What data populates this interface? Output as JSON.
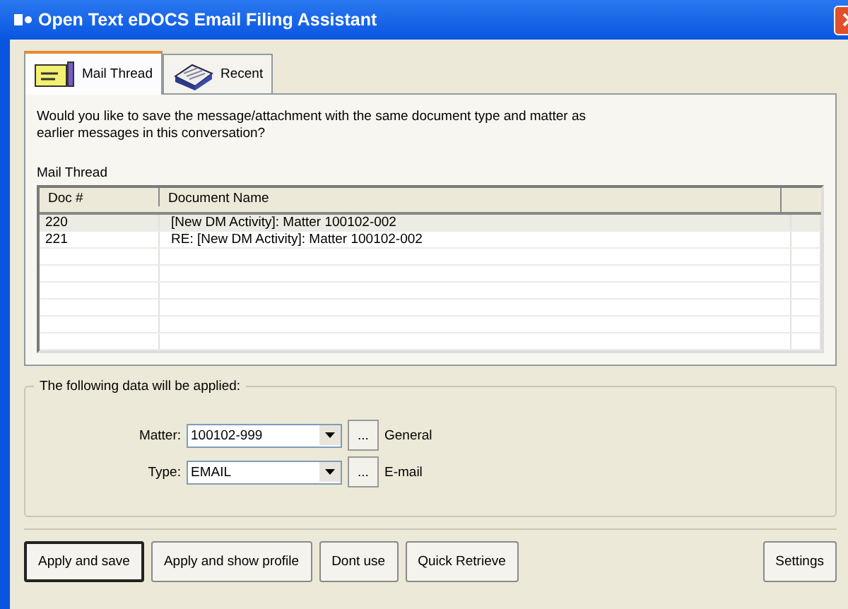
{
  "window": {
    "title": "Open Text eDOCS Email Filing Assistant"
  },
  "tabs": [
    {
      "label": "Mail Thread",
      "kind": "mail",
      "selected": true
    },
    {
      "label": "Recent",
      "kind": "book",
      "selected": false
    }
  ],
  "prompt": "Would you like to save the message/attachment with the same document type and matter as earlier messages in this conversation?",
  "thread": {
    "label": "Mail Thread",
    "columns": [
      "Doc #",
      "Document Name"
    ],
    "rows": [
      {
        "doc": "220",
        "name": "[New DM Activity]: Matter 100102-002",
        "selected": true
      },
      {
        "doc": "221",
        "name": "RE: [New DM Activity]: Matter 100102-002",
        "selected": false
      }
    ]
  },
  "applied": {
    "legend": "The following data will be applied:",
    "fields": [
      {
        "label": "Matter:",
        "value": "100102-999",
        "browse": "...",
        "description": "General"
      },
      {
        "label": "Type:",
        "value": "EMAIL",
        "browse": "...",
        "description": "E-mail"
      }
    ]
  },
  "buttons": [
    {
      "label": "Apply and save",
      "default": true
    },
    {
      "label": "Apply and show profile",
      "default": false
    },
    {
      "label": "Dont use",
      "default": false
    },
    {
      "label": "Quick Retrieve",
      "default": false
    },
    {
      "label": "Settings",
      "default": false
    }
  ]
}
